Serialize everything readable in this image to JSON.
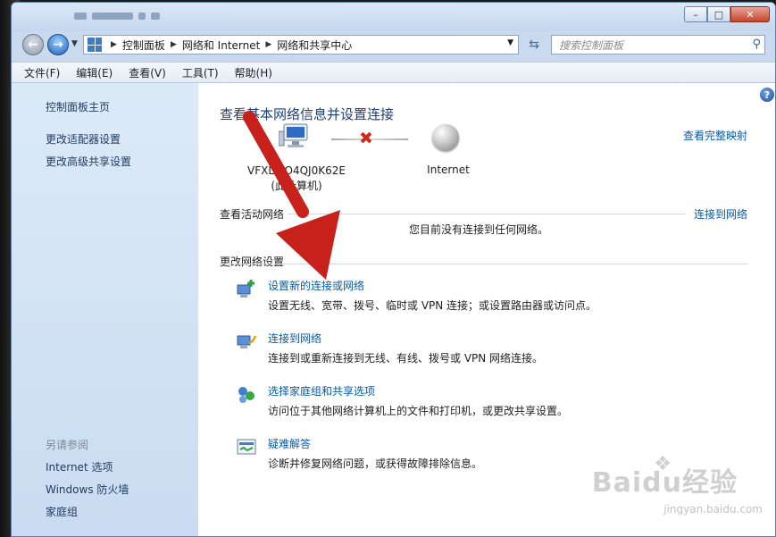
{
  "window": {
    "controls": {
      "minimize": "–",
      "maximize": "□",
      "close": "✕"
    }
  },
  "nav": {
    "breadcrumb": [
      "控制面板",
      "网络和 Internet",
      "网络和共享中心"
    ],
    "search_placeholder": "搜索控制面板"
  },
  "menu": [
    "文件(F)",
    "编辑(E)",
    "查看(V)",
    "工具(T)",
    "帮助(H)"
  ],
  "sidebar": {
    "items": [
      "控制面板主页",
      "更改适配器设置",
      "更改高级共享设置"
    ],
    "see_also_heading": "另请参阅",
    "see_also": [
      "Internet 选项",
      "Windows 防火墙",
      "家庭组"
    ]
  },
  "main": {
    "title": "查看基本网络信息并设置连接",
    "full_map_link": "查看完整映射",
    "computer_name_line1": "VFXL  5O4QJ0K62E",
    "computer_name_line2": "(此计算机)",
    "internet_label": "Internet",
    "active_networks_heading": "查看活动网络",
    "connect_link": "连接到网络",
    "no_connection_text": "您目前没有连接到任何网络。",
    "change_settings_heading": "更改网络设置",
    "tasks": [
      {
        "link": "设置新的连接或网络",
        "desc": "设置无线、宽带、拨号、临时或 VPN 连接；或设置路由器或访问点。",
        "icon": "new-connection-icon"
      },
      {
        "link": "连接到网络",
        "desc": "连接到或重新连接到无线、有线、拨号或 VPN 网络连接。",
        "icon": "connect-network-icon"
      },
      {
        "link": "选择家庭组和共享选项",
        "desc": "访问位于其他网络计算机上的文件和打印机，或更改共享设置。",
        "icon": "homegroup-icon"
      },
      {
        "link": "疑难解答",
        "desc": "诊断并修复网络问题，或获得故障排除信息。",
        "icon": "troubleshoot-icon"
      }
    ]
  },
  "watermark": {
    "brand": "Baidu经验",
    "url": "jingyan.baidu.com"
  },
  "colors": {
    "link": "#0b5aa5",
    "title": "#1e3e78",
    "arrow": "#c8201a",
    "sidebar_bg": "#d4e4f6"
  }
}
